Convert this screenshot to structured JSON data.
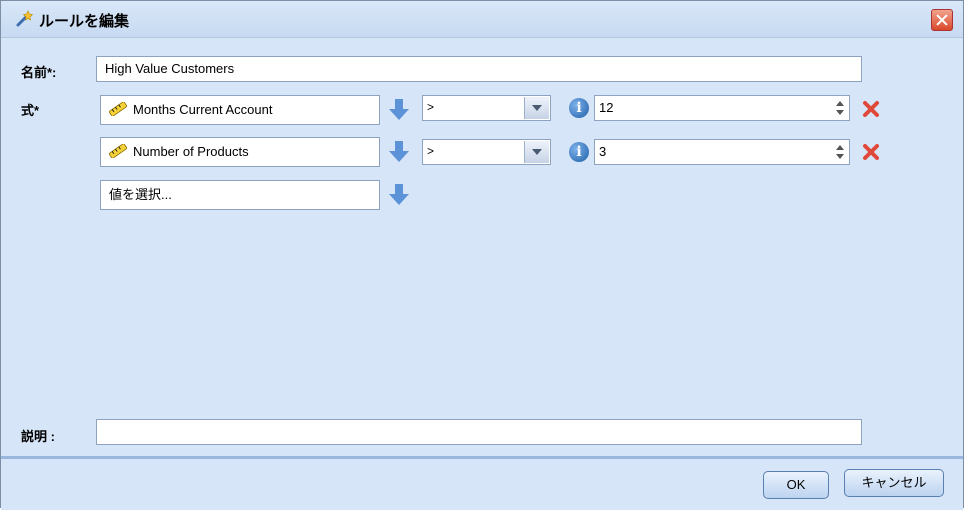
{
  "window": {
    "title": "ルールを編集"
  },
  "form": {
    "name_label": "名前*:",
    "name_value": "High Value Customers",
    "expr_label": "式*",
    "desc_label": "説明 :",
    "desc_value": ""
  },
  "rules": [
    {
      "field": "Months Current Account",
      "operator": ">",
      "value": "12"
    },
    {
      "field": "Number of Products",
      "operator": ">",
      "value": "3"
    }
  ],
  "select_placeholder": "値を選択...",
  "icons": {
    "title": "magic-wand-icon",
    "field": "ruler-icon",
    "arrow": "arrow-down-icon",
    "info": "info-icon",
    "delete": "delete-x-icon",
    "close": "close-icon"
  },
  "footer": {
    "ok_label": "OK",
    "cancel_label": "キャンセル"
  },
  "colors": {
    "background": "#d6e5f7",
    "accent": "#5b92d8",
    "delete": "#e0483a"
  }
}
